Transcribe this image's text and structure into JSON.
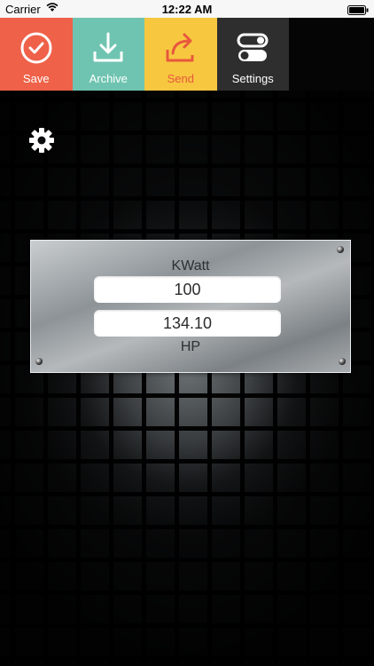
{
  "status_bar": {
    "carrier": "Carrier",
    "time": "12:22 AM"
  },
  "toolbar": {
    "save_label": "Save",
    "archive_label": "Archive",
    "send_label": "Send",
    "settings_label": "Settings"
  },
  "colors": {
    "save": "#ef6149",
    "archive": "#6fc4b1",
    "send": "#f7c740",
    "settings": "#2e2e2e"
  },
  "converter": {
    "top_unit": "KWatt",
    "top_value": "100",
    "bottom_value": "134.10",
    "bottom_unit": "HP"
  },
  "icons": {
    "save": "check-circle-icon",
    "archive": "download-tray-icon",
    "send": "share-arrow-icon",
    "settings": "toggles-icon",
    "options": "gear-icon"
  }
}
